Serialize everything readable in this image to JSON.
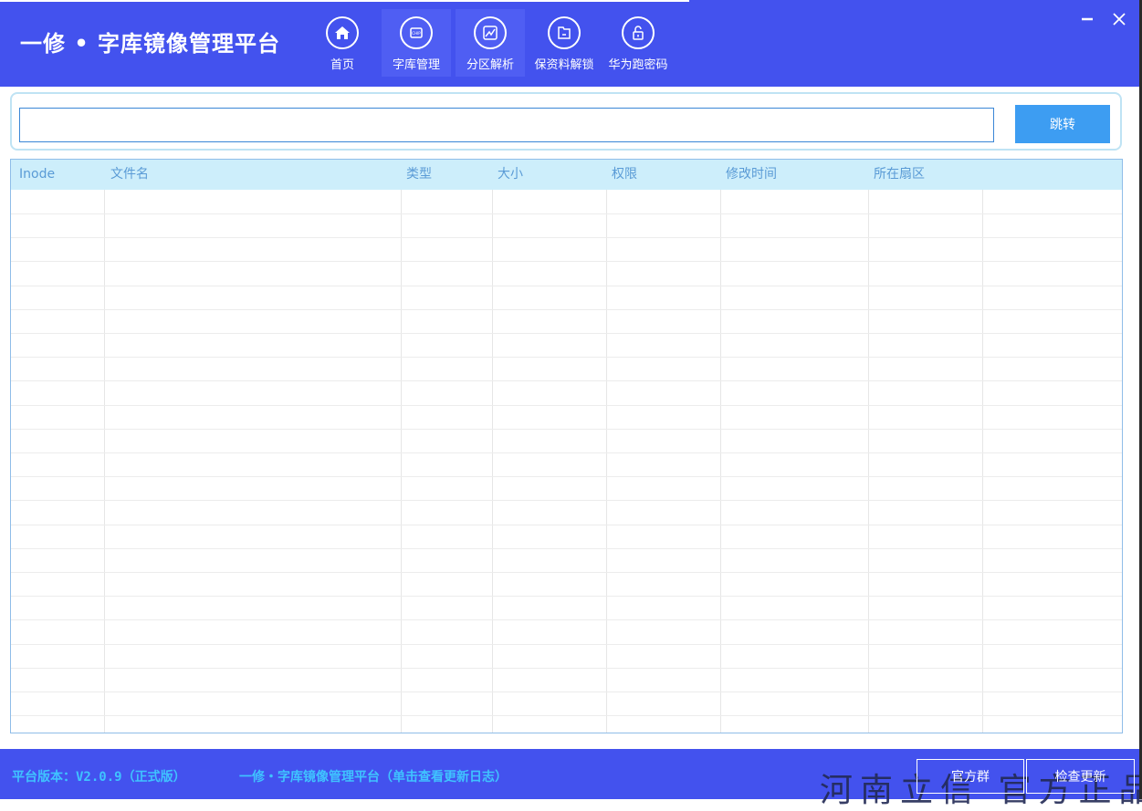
{
  "app": {
    "title": "一修 • 字库镜像管理平台"
  },
  "nav": [
    {
      "label": "首页",
      "icon": "home-icon",
      "active": false
    },
    {
      "label": "字库管理",
      "icon": "chip-icon",
      "active": true
    },
    {
      "label": "分区解析",
      "icon": "chart-icon",
      "active": true
    },
    {
      "label": "保资料解锁",
      "icon": "folder-icon",
      "active": false
    },
    {
      "label": "华为跑密码",
      "icon": "unlock-icon",
      "active": false
    }
  ],
  "window": {
    "minimize_icon": "minimize-icon",
    "close_icon": "close-icon"
  },
  "search": {
    "value": "",
    "placeholder": "",
    "jump_label": "跳转"
  },
  "table": {
    "columns": [
      "Inode",
      "文件名",
      "类型",
      "大小",
      "权限",
      "修改时间",
      "所在扇区"
    ],
    "rows": []
  },
  "footer": {
    "version": "平台版本：V2.0.9（正式版）",
    "changelog_link": "一修・字库镜像管理平台（单击查看更新日志）",
    "watermark": "河南立信 官方正品",
    "group_button": "官方群",
    "update_button": "检查更新"
  },
  "colors": {
    "header_bg": "#4352ee",
    "accent_button": "#3d9df2",
    "table_header_bg": "#cdeefb",
    "footer_text": "#3fc3ff"
  }
}
